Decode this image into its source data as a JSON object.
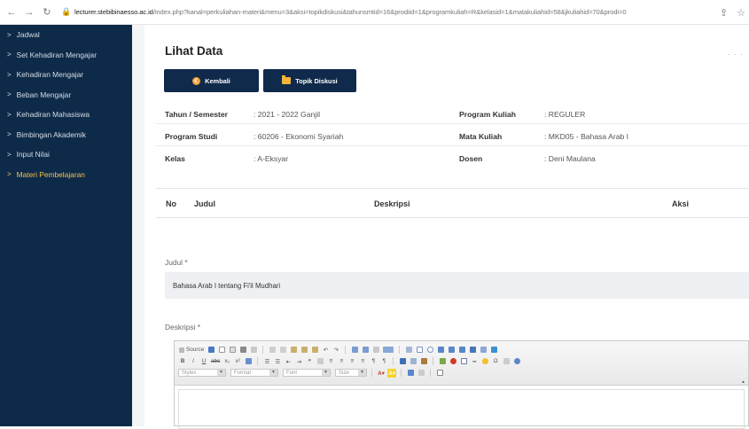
{
  "browser": {
    "url_host": "lecturer.stebibinaesso.ac.id",
    "url_path": "/index.php?kanal=perkuliahan-materi&menu=3&aksi=topikdiskusi&tahunsmtid=16&prodiid=1&programkuliah=R&kelasid=1&matakuliahid=58&jkuliahid=70&prodi=0"
  },
  "sidebar": {
    "items": [
      {
        "label": "Jadwal"
      },
      {
        "label": "Set Kehadiran Mengajar"
      },
      {
        "label": "Kehadiran Mengajar"
      },
      {
        "label": "Beban Mengajar"
      },
      {
        "label": "Kehadiran Mahasiswa"
      },
      {
        "label": "Bimbingan Akademik"
      },
      {
        "label": "Input Nilai"
      },
      {
        "label": "Materi Pembelajaran"
      }
    ],
    "active_index": 7
  },
  "page": {
    "title": "Lihat Data",
    "back_button": "Kembali",
    "topic_button": "Topik Diskusi"
  },
  "info": {
    "tahun_label": "Tahun / Semester",
    "tahun_value": ": 2021 - 2022 Ganjil",
    "program_label": "Program Kuliah",
    "program_value": ": REGULER",
    "prodi_label": "Program Studi",
    "prodi_value": ": 60206 - Ekonomi Syariah",
    "matkul_label": "Mata Kuliah",
    "matkul_value": ": MKD05 - Bahasa Arab I",
    "kelas_label": "Kelas",
    "kelas_value": ": A-Eksyar",
    "dosen_label": "Dosen",
    "dosen_value": ": Deni Maulana"
  },
  "table": {
    "columns": [
      "No",
      "Judul",
      "Deskripsi",
      "Aksi"
    ]
  },
  "form": {
    "judul_label": "Judul *",
    "judul_value": "Bahasa Arab I tentang Fi'il Mudhari",
    "deskripsi_label": "Deskripsi *"
  },
  "editor": {
    "source_label": "Source",
    "styles_label": "Styles",
    "format_label": "Format",
    "font_label": "Font",
    "size_label": "Size"
  }
}
